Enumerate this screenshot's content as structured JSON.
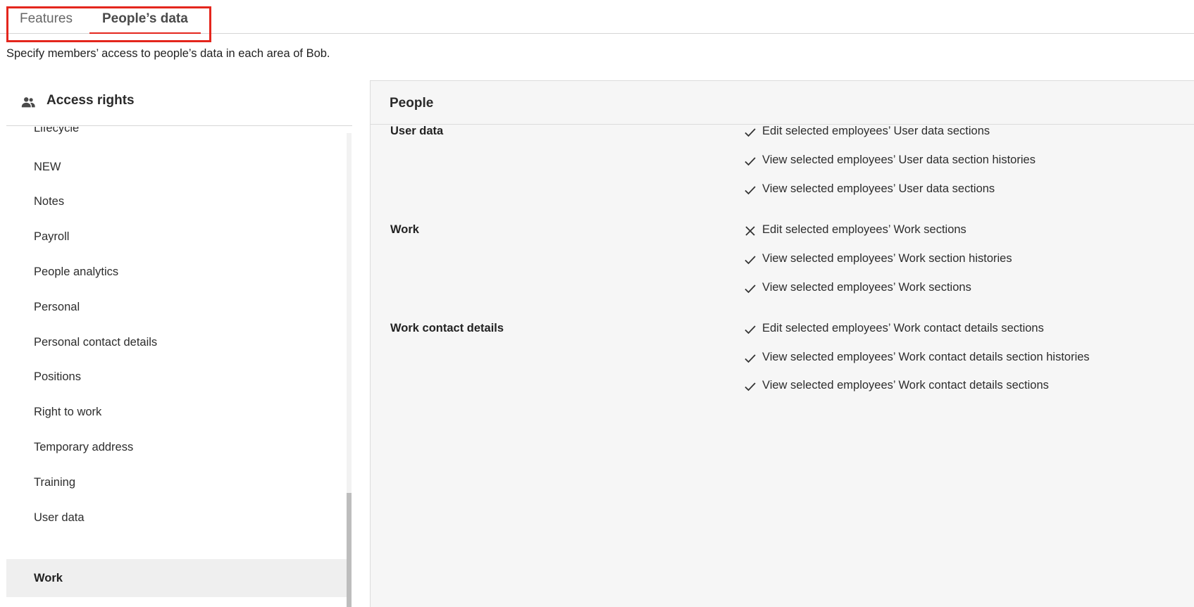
{
  "tabs": [
    {
      "label": "Features"
    },
    {
      "label": "People’s data"
    }
  ],
  "subtitle": "Specify members’ access to people’s data in each area of Bob.",
  "left_panel": {
    "title": "Access rights",
    "icon": "people-icon",
    "items": [
      {
        "label": "Lifecycle"
      },
      {
        "label": "NEW"
      },
      {
        "label": "Notes"
      },
      {
        "label": "Payroll"
      },
      {
        "label": "People analytics"
      },
      {
        "label": "Personal"
      },
      {
        "label": "Personal contact details"
      },
      {
        "label": "Positions"
      },
      {
        "label": "Right to work"
      },
      {
        "label": "Temporary address"
      },
      {
        "label": "Training"
      },
      {
        "label": "User data"
      },
      {
        "label": "Work",
        "selected": true
      }
    ]
  },
  "right_panel": {
    "title": "People",
    "sections": [
      {
        "label": "User data",
        "permissions": [
          {
            "text": "Edit selected employees’ User data sections",
            "granted": true
          },
          {
            "text": "View selected employees’ User data section histories",
            "granted": true
          },
          {
            "text": "View selected employees’ User data sections",
            "granted": true
          }
        ]
      },
      {
        "label": "Work",
        "permissions": [
          {
            "text": "Edit selected employees’ Work sections",
            "granted": false
          },
          {
            "text": "View selected employees’ Work section histories",
            "granted": true
          },
          {
            "text": "View selected employees’ Work sections",
            "granted": true
          }
        ]
      },
      {
        "label": "Work contact details",
        "permissions": [
          {
            "text": "Edit selected employees’ Work contact details sections",
            "granted": true
          },
          {
            "text": "View selected employees’ Work contact details section histories",
            "granted": true
          },
          {
            "text": "View selected employees’ Work contact details sections",
            "granted": true
          }
        ]
      }
    ]
  },
  "colors": {
    "accent": "#e4261d",
    "selected_bg": "#efefef",
    "panel_bg": "#f6f6f6"
  }
}
